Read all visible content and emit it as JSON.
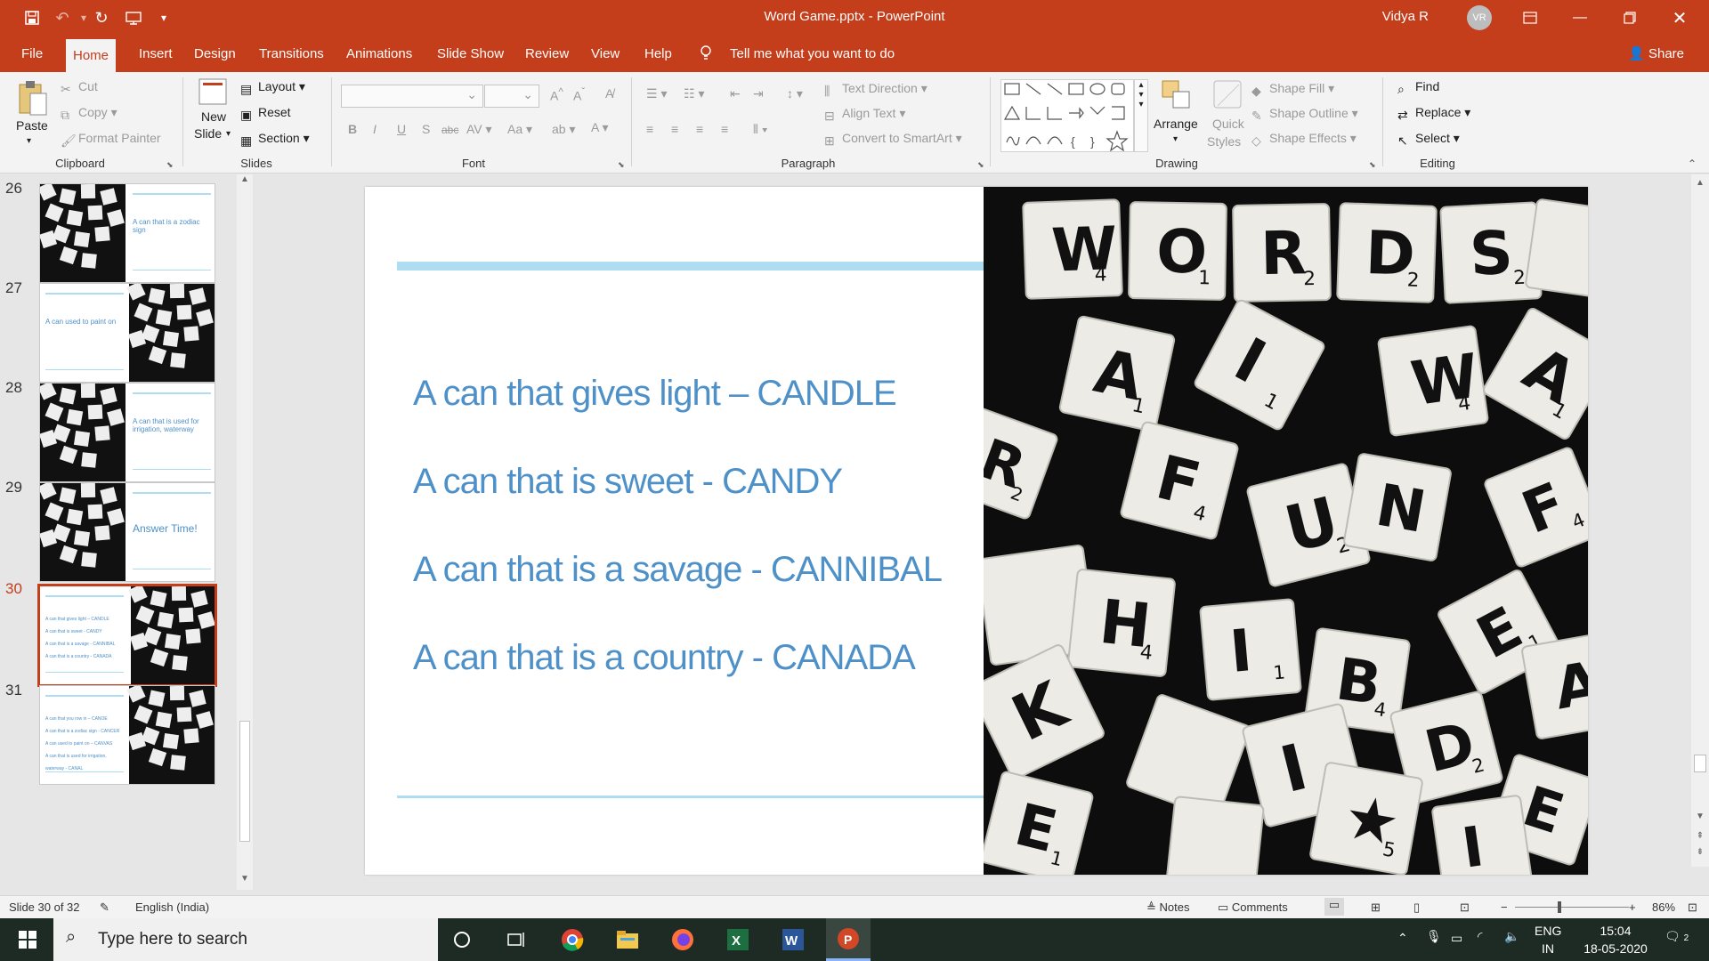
{
  "window": {
    "title": "Word Game.pptx  -  PowerPoint",
    "user_name": "Vidya R",
    "user_initials": "VR"
  },
  "tabs": [
    "File",
    "Home",
    "Insert",
    "Design",
    "Transitions",
    "Animations",
    "Slide Show",
    "Review",
    "View",
    "Help"
  ],
  "tell_me": "Tell me what you want to do",
  "share": "Share",
  "ribbon": {
    "clipboard": {
      "paste": "Paste",
      "cut": "Cut",
      "copy": "Copy",
      "format_painter": "Format Painter",
      "label": "Clipboard"
    },
    "slides": {
      "new_slide": "New",
      "new_slide_2": "Slide",
      "layout": "Layout",
      "reset": "Reset",
      "section": "Section",
      "label": "Slides"
    },
    "font": {
      "label": "Font",
      "bold": "B",
      "italic": "I",
      "underline": "U",
      "shadow": "S",
      "strike": "abc"
    },
    "paragraph": {
      "label": "Paragraph",
      "text_direction": "Text Direction",
      "align_text": "Align Text",
      "smartart": "Convert to SmartArt"
    },
    "drawing": {
      "label": "Drawing",
      "arrange": "Arrange",
      "quick_styles": "Quick",
      "quick_styles_2": "Styles",
      "shape_fill": "Shape Fill",
      "shape_outline": "Shape Outline",
      "shape_effects": "Shape Effects"
    },
    "editing": {
      "label": "Editing",
      "find": "Find",
      "replace": "Replace",
      "select": "Select"
    }
  },
  "thumbnails": [
    {
      "num": "26",
      "text": "A can that is a zodiac sign",
      "layout": "img-left"
    },
    {
      "num": "27",
      "text": "A can used to paint on",
      "layout": "img-right"
    },
    {
      "num": "28",
      "text": "A can that is used for irrigation, waterway",
      "layout": "img-left"
    },
    {
      "num": "29",
      "text": "Answer Time!",
      "layout": "img-left"
    },
    {
      "num": "30",
      "text": "A can that gives light – CANDLE / A can that is sweet - CANDY / A can that is a savage - CANNIBAL / A can that is a country - CANADA",
      "layout": "img-right",
      "active": true
    },
    {
      "num": "31",
      "text": "A can that you row in – CANOE / A can that is a zodiac sign - CANCER / A can used to paint on – CANVAS / A can that is used for irrigation, waterway - CANAL",
      "layout": "img-right"
    }
  ],
  "slide": {
    "bullets": [
      "A can that gives light – CANDLE",
      "A can that is sweet - CANDY",
      "A can that is a savage - CANNIBAL",
      "A can that is a country - CANADA"
    ],
    "image_letters": [
      "W",
      "O",
      "R",
      "D",
      "S"
    ],
    "image_sub": [
      "4",
      "1",
      "2",
      "2",
      "2"
    ]
  },
  "status": {
    "slide_of": "Slide 30 of 32",
    "language": "English (India)",
    "notes": "Notes",
    "comments": "Comments",
    "zoom": "86%"
  },
  "taskbar": {
    "search_placeholder": "Type here to search",
    "lang1": "ENG",
    "lang2": "IN",
    "time": "15:04",
    "date": "18-05-2020",
    "notif_count": "2"
  },
  "colors": {
    "accent": "#c43e1c",
    "slide_text": "#4e90c8",
    "slide_line": "#aedcf0"
  }
}
